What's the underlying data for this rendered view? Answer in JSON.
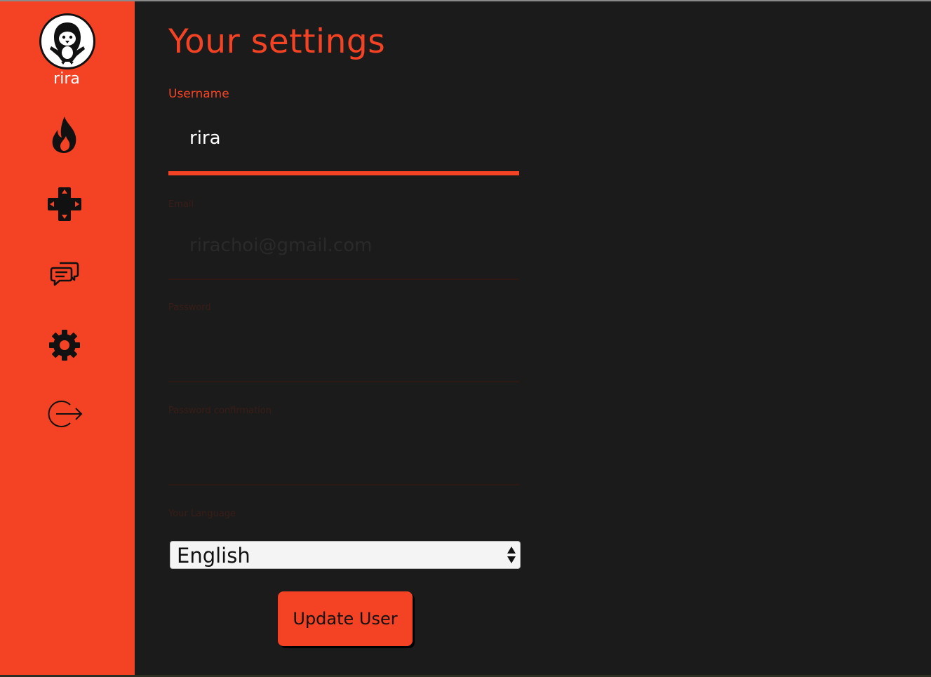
{
  "sidebar": {
    "username": "rira",
    "avatar_icon": "penguin-avatar-icon",
    "nav": [
      {
        "id": "popular",
        "icon": "flame-icon"
      },
      {
        "id": "games",
        "icon": "dpad-icon"
      },
      {
        "id": "chat",
        "icon": "chat-bubbles-icon"
      },
      {
        "id": "settings",
        "icon": "gear-icon"
      },
      {
        "id": "logout",
        "icon": "logout-icon"
      }
    ]
  },
  "main": {
    "title": "Your settings",
    "username": {
      "label": "Username",
      "value": "rira"
    },
    "email": {
      "label": "Email",
      "value": "rirachoi@gmail.com"
    },
    "password": {
      "label": "Password",
      "value": ""
    },
    "password_confirmation": {
      "label": "Password confirmation",
      "value": ""
    },
    "language": {
      "label": "Your Language",
      "selected": "English"
    },
    "submit_label": "Update User"
  },
  "colors": {
    "accent": "#f44324",
    "background": "#1b1b1b",
    "text_light": "#ffffff",
    "icon_dark": "#111111"
  }
}
